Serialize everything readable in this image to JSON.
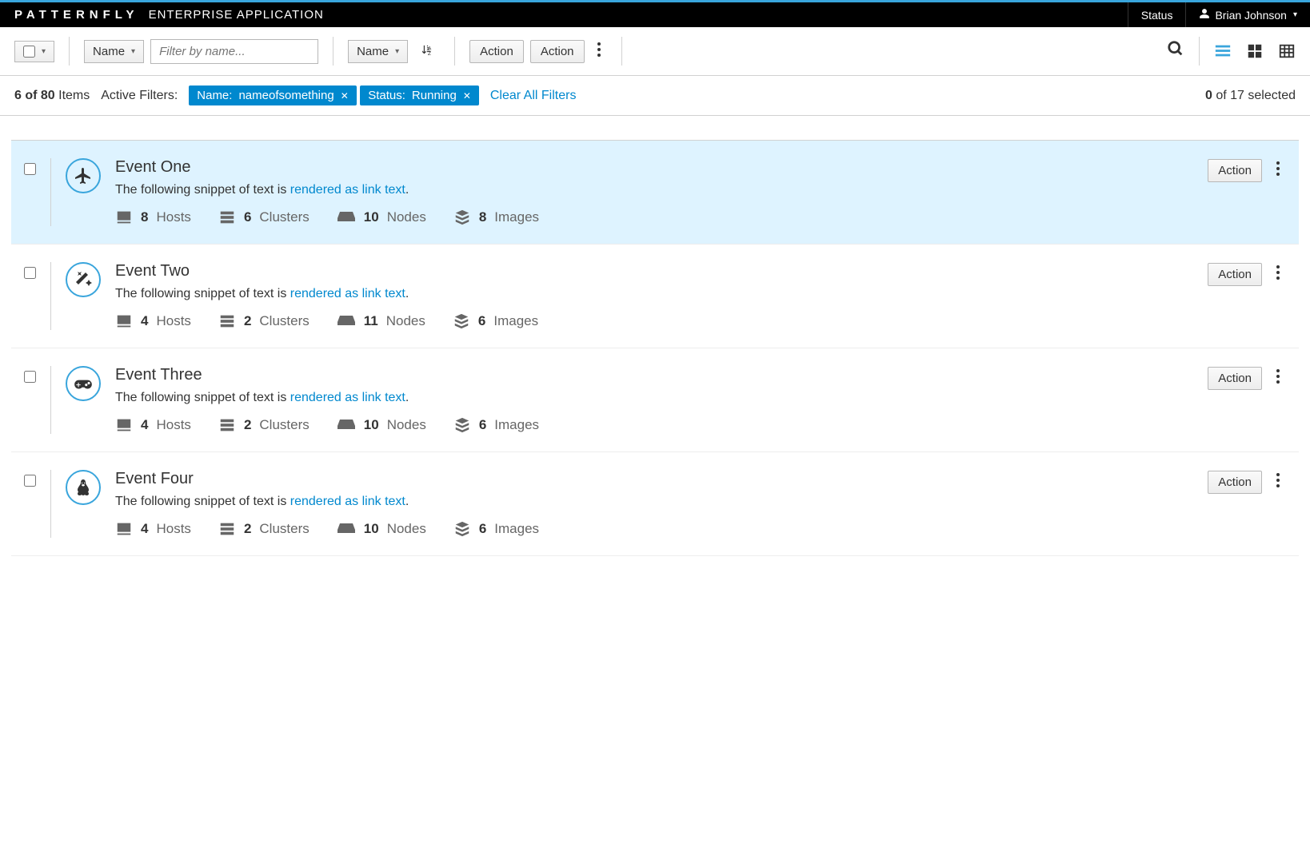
{
  "topbar": {
    "brand_main": "PATTERNFLY",
    "brand_sub": "ENTERPRISE APPLICATION",
    "status_label": "Status",
    "user_name": "Brian Johnson"
  },
  "toolbar": {
    "filter_dropdown": "Name",
    "filter_placeholder": "Filter by name...",
    "sort_dropdown": "Name",
    "action1": "Action",
    "action2": "Action"
  },
  "filters": {
    "count_text_prefix": "6 of 80",
    "count_text_suffix": " Items",
    "active_filters_label": "Active Filters:",
    "chips": [
      {
        "key": "Name:",
        "value": "nameofsomething"
      },
      {
        "key": "Status:",
        "value": "Running"
      }
    ],
    "clear_all": "Clear All Filters",
    "selected_prefix": "0",
    "selected_suffix": " of 17 selected"
  },
  "labels": {
    "hosts": "Hosts",
    "clusters": "Clusters",
    "nodes": "Nodes",
    "images": "Images",
    "snippet": "The following snippet of text is ",
    "link": "rendered as link text"
  },
  "rows": [
    {
      "title": "Event One",
      "icon": "plane",
      "hosts": "8",
      "clusters": "6",
      "nodes": "10",
      "images": "8",
      "action": "Action",
      "hover": true
    },
    {
      "title": "Event Two",
      "icon": "wand",
      "hosts": "4",
      "clusters": "2",
      "nodes": "11",
      "images": "6",
      "action": "Action",
      "hover": false
    },
    {
      "title": "Event Three",
      "icon": "gamepad",
      "hosts": "4",
      "clusters": "2",
      "nodes": "10",
      "images": "6",
      "action": "Action",
      "hover": false
    },
    {
      "title": "Event Four",
      "icon": "linux",
      "hosts": "4",
      "clusters": "2",
      "nodes": "10",
      "images": "6",
      "action": "Action",
      "hover": false
    }
  ]
}
